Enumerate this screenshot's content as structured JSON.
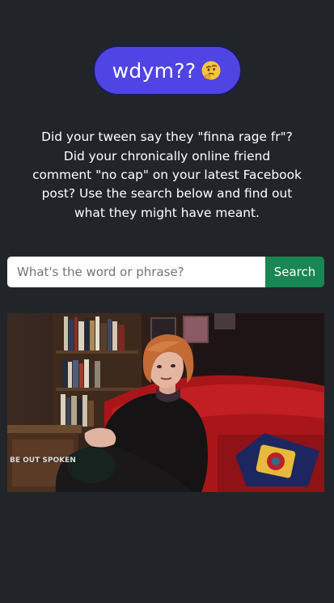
{
  "logo": {
    "text": "wdym??",
    "emoji_icon": "thinking-face-icon"
  },
  "intro": {
    "text": "Did your tween say they \"finna rage fr\"? Did your chronically online friend comment \"no cap\" on your latest Facebook post? Use the search below and find out what they might have meant."
  },
  "search": {
    "placeholder": "What's the word or phrase?",
    "value": "",
    "button_label": "Search"
  },
  "video": {
    "watermark": "BE OUT SPOKEN"
  },
  "colors": {
    "background": "#212529",
    "logo_pill": "#5044e4",
    "search_button": "#198754"
  }
}
